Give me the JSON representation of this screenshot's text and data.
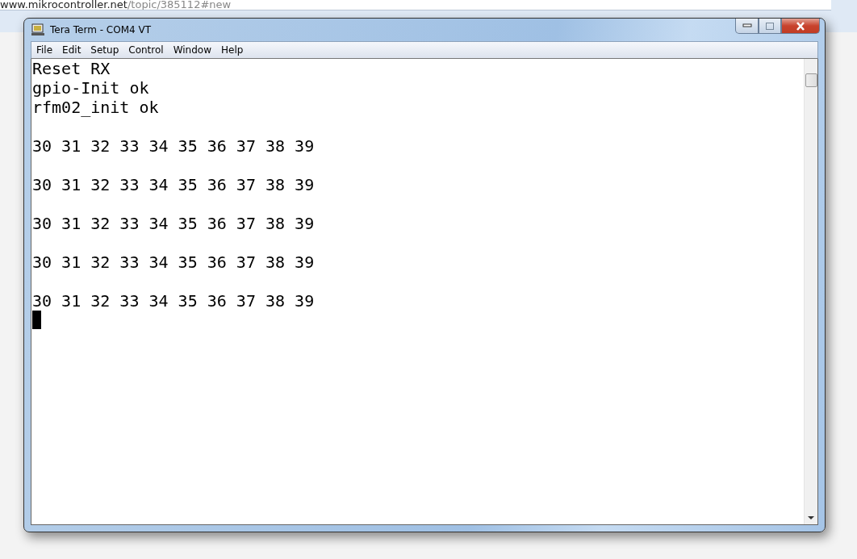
{
  "browser": {
    "url_host": "www.mikrocontroller.net",
    "url_path": "/topic/385112#new"
  },
  "window": {
    "title": "Tera Term - COM4 VT",
    "active": true
  },
  "menu": [
    {
      "label": "File"
    },
    {
      "label": "Edit"
    },
    {
      "label": "Setup"
    },
    {
      "label": "Control"
    },
    {
      "label": "Window"
    },
    {
      "label": "Help"
    }
  ],
  "terminal": {
    "blocks": [
      [
        "Reset RX",
        "gpio-Init ok",
        "rfm02_init ok"
      ],
      [
        "30 31 32 33 34 35 36 37 38 39"
      ],
      [
        "30 31 32 33 34 35 36 37 38 39"
      ],
      [
        "30 31 32 33 34 35 36 37 38 39"
      ],
      [
        "30 31 32 33 34 35 36 37 38 39"
      ],
      [
        "30 31 32 33 34 35 36 37 38 39"
      ]
    ],
    "cursor": true
  }
}
